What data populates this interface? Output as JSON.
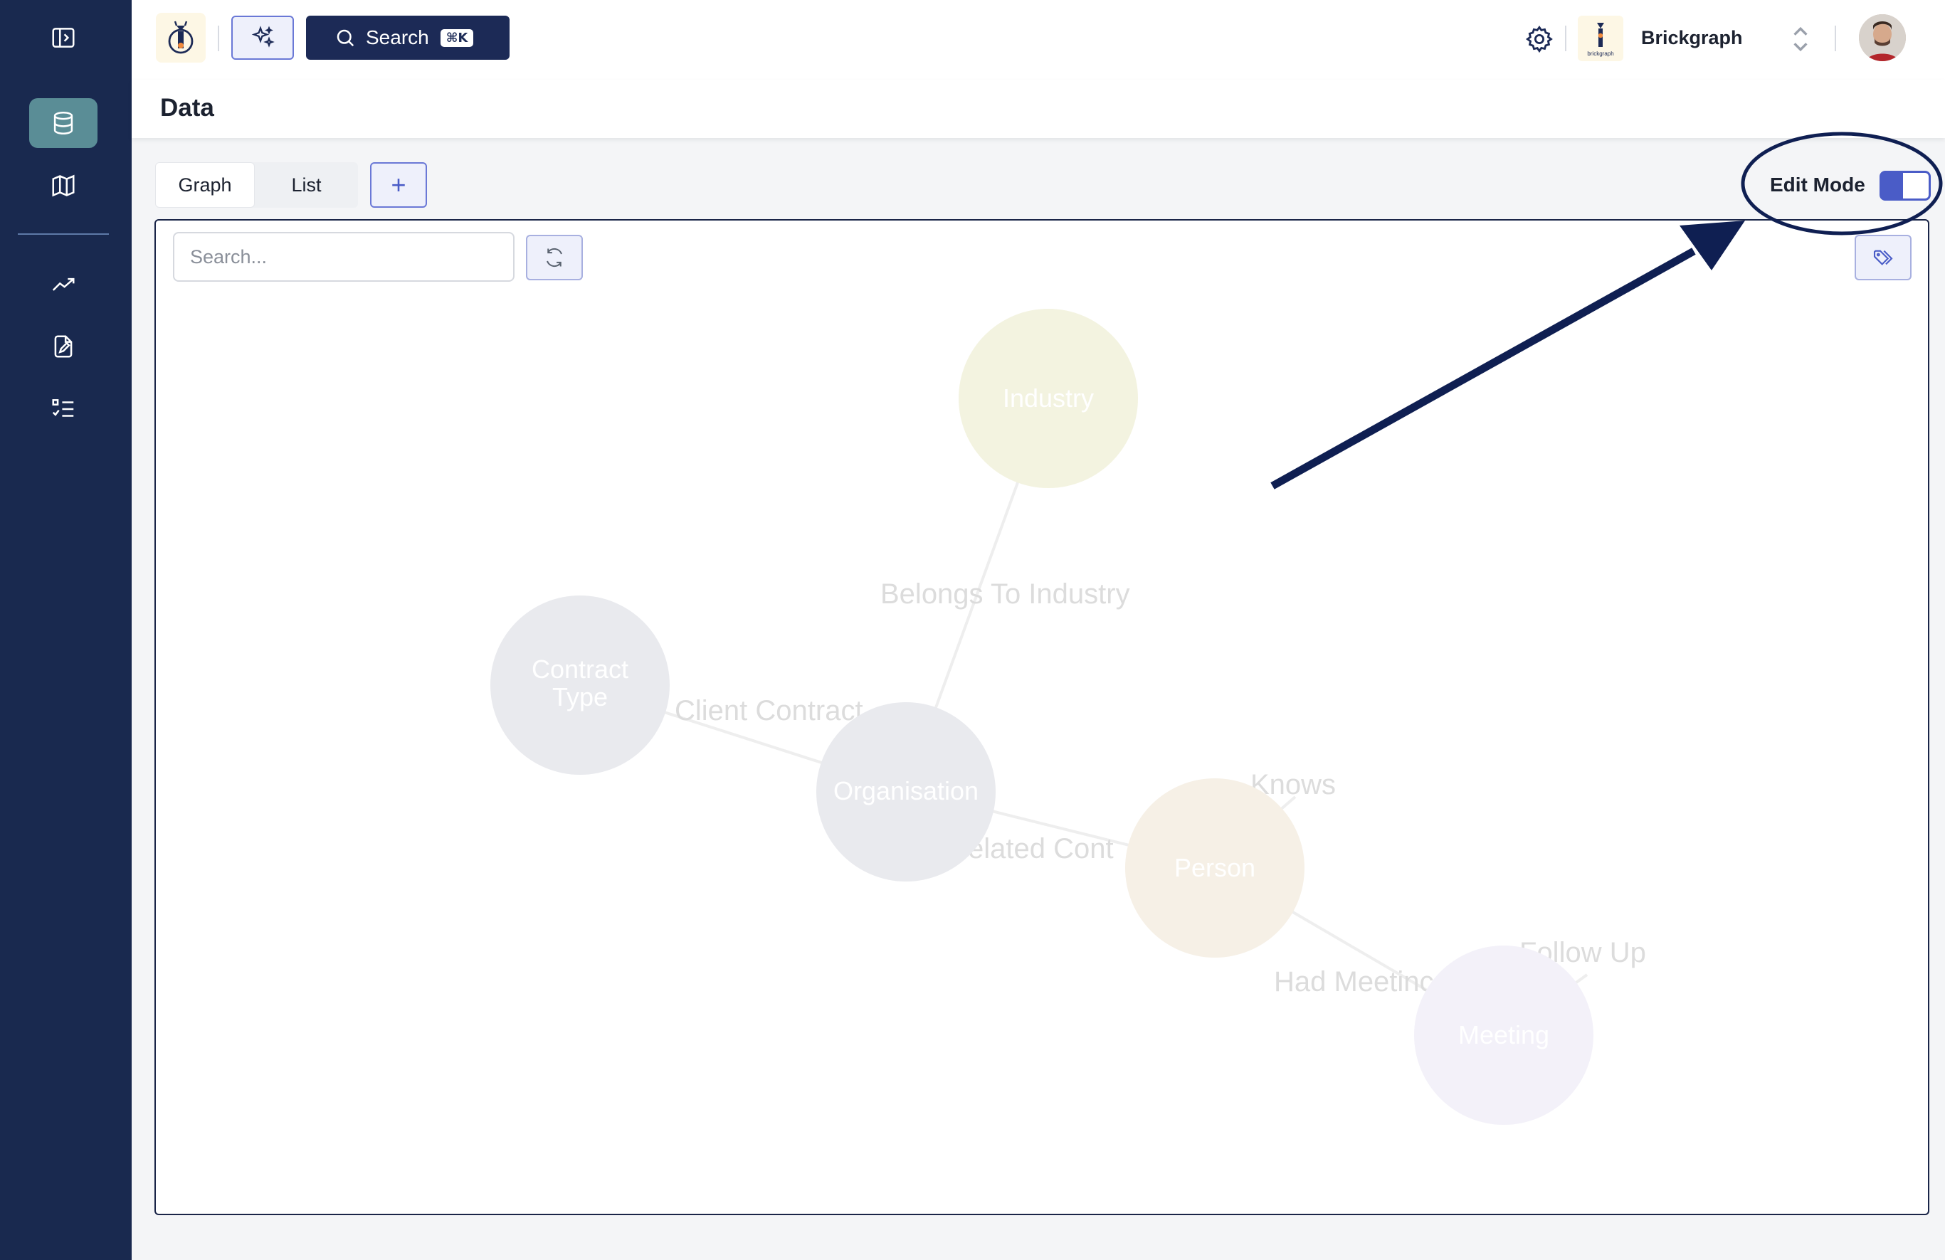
{
  "topbar": {
    "search_label": "Search",
    "search_shortcut": "⌘K",
    "org_name": "Brickgraph",
    "org_logo_text": "brickgraph"
  },
  "page": {
    "title": "Data"
  },
  "view_tabs": [
    {
      "label": "Graph",
      "selected": true
    },
    {
      "label": "List",
      "selected": false
    }
  ],
  "add_button_label": "+",
  "edit_mode": {
    "label": "Edit Mode",
    "enabled": true
  },
  "graph_search": {
    "placeholder": "Search..."
  },
  "graph": {
    "nodes": [
      {
        "label_lines": [
          "Industry"
        ],
        "color": "#f3f3e0"
      },
      {
        "label_lines": [
          "Contract",
          "Type"
        ],
        "color": "#e9eaee"
      },
      {
        "label_lines": [
          "Organisation"
        ],
        "color": "#e9eaee"
      },
      {
        "label_lines": [
          "Person"
        ],
        "color": "#f6f0e6"
      },
      {
        "label_lines": [
          "Meeting"
        ],
        "color": "#f3f1f9"
      }
    ],
    "edges": [
      {
        "label": "Belongs To Industry"
      },
      {
        "label": "Client Contract"
      },
      {
        "label": "elated Cont"
      },
      {
        "label": "Knows"
      },
      {
        "label": "Had Meetinc"
      },
      {
        "label": "Follow Up"
      }
    ]
  },
  "colors": {
    "sidebar": "#19294f",
    "sidebar_active": "#5a8d96",
    "accent": "#4a5cc7",
    "annotation": "#0f1f52"
  }
}
